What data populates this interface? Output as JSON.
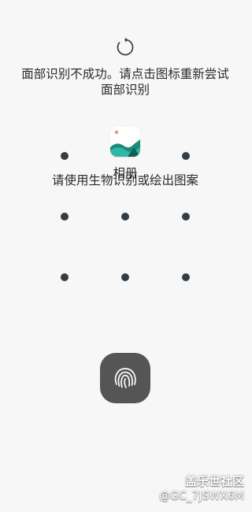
{
  "status": {
    "retry_icon": "refresh-icon",
    "line1": "面部识别不成功。请点击图标重新尝试",
    "line2": "面部识别"
  },
  "app": {
    "icon": "gallery-icon",
    "name": "相册"
  },
  "prompt": "请使用生物识别或绘出图案",
  "pattern": {
    "dot_color": "#333d44",
    "rows": 3,
    "cols": 3
  },
  "fingerprint": {
    "icon": "fingerprint-icon",
    "color": "#555555"
  },
  "watermark": {
    "line1": "盖乐世社区",
    "line2": "@GC_7JSWX6M"
  }
}
